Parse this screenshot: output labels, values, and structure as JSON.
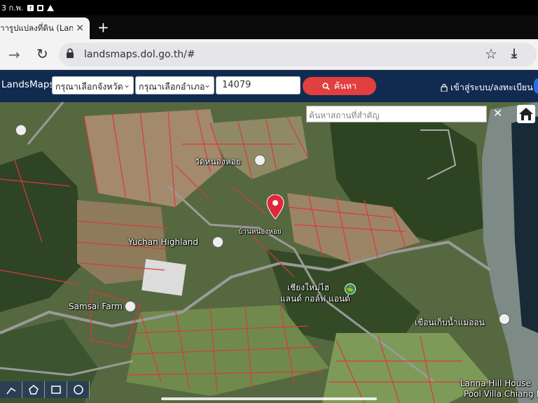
{
  "status_bar": {
    "time": "3 ก.พ."
  },
  "tab": {
    "title": "าารูปแปลงที่ดิน (Lan",
    "close_label": "×",
    "new_tab_label": "+"
  },
  "toolbar": {
    "url": "landsmaps.dol.go.th/#"
  },
  "site": {
    "brand": "LandsMaps",
    "province_select": "กรุณาเลือกจังหวัด",
    "district_select": "กรุณาเลือกอำเภอ",
    "parcel_number": "14079",
    "search_button": "ค้นหา",
    "login_label": "เข้าสู่ระบบ/ลงทะเบียน"
  },
  "map": {
    "search_placeholder": "ค้นหาสถานที่สำคัญ",
    "labels": {
      "wat": "วัดหนองหอย",
      "village": "บ้านหนองหอย",
      "yuchan": "Yuchan Highland",
      "samsai": "Samsai Farm",
      "golf_line1": "เชียงใหม่ไฮ",
      "golf_line2": "แลนด์ กอล์ฟ แอนด์",
      "dam": "เขื่อนเก็บน้ำแม่ออน",
      "lanna": "Lanna Hill House",
      "lanna2": "Pool Villa Chiang M"
    }
  },
  "colors": {
    "header_bg": "#112b50",
    "search_button": "#e23f3f",
    "pin": "#e0283a",
    "parcel_lines": "#d93a3a"
  }
}
